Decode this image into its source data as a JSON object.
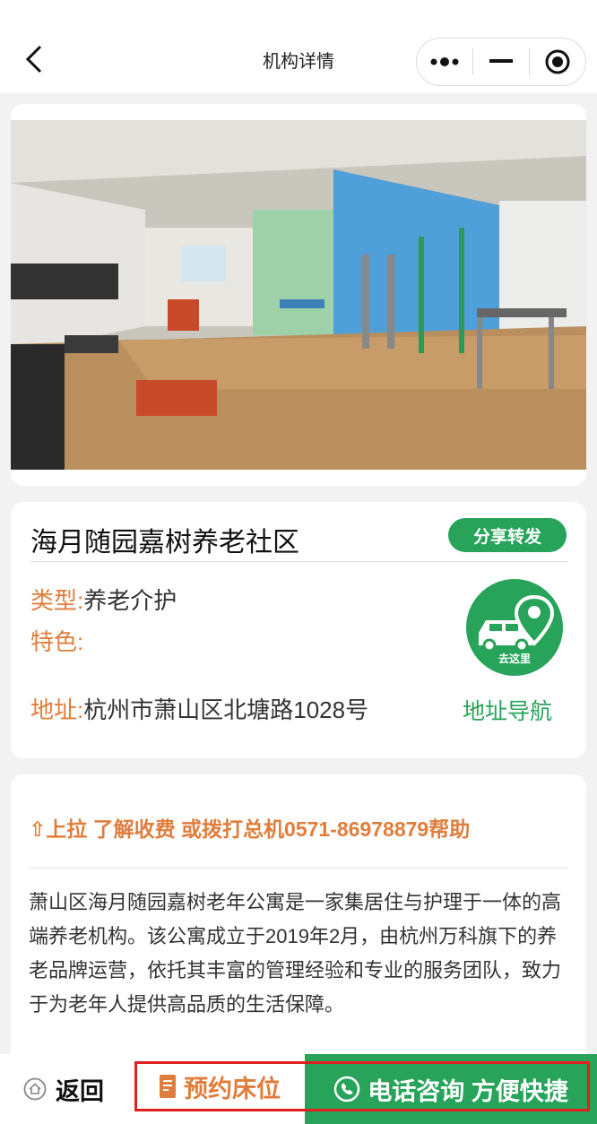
{
  "navbar": {
    "title": "机构详情"
  },
  "carousel": {
    "slide_count": 7,
    "active_index": 0
  },
  "info": {
    "org_name": "海月随园嘉树养老社区",
    "share_label": "分享转发",
    "type_label": "类型:",
    "type_value": "养老介护",
    "feature_label": "特色:",
    "feature_value": "",
    "address_label": "地址:",
    "address_value": "杭州市萧山区北塘路1028号",
    "goto_label": "去这里",
    "nav_link": "地址导航"
  },
  "description": {
    "pull_tip": "⇧上拉 了解收费 或拨打总机0571-86978879帮助",
    "text": "萧山区海月随园嘉树老年公寓是一家集居住与护理于一体的高端养老机构。该公寓成立于2019年2月，由杭州万科旗下的养老品牌运营，依托其丰富的管理经验和专业的服务团队，致力于为老年人提供高品质的生活保障。"
  },
  "bottom_bar": {
    "back_label": "返回",
    "book_label": "预约床位",
    "call_label": "电话咨询 方便快捷"
  },
  "colors": {
    "accent_green": "#27a35a",
    "accent_orange": "#e07d3c",
    "active_dot": "#f39c12",
    "highlight_red": "#e02020"
  },
  "icons": [
    "back-chevron-icon",
    "more-dots-icon",
    "minimize-icon",
    "record-icon",
    "car-location-icon",
    "home-icon",
    "document-icon",
    "phone-icon"
  ]
}
